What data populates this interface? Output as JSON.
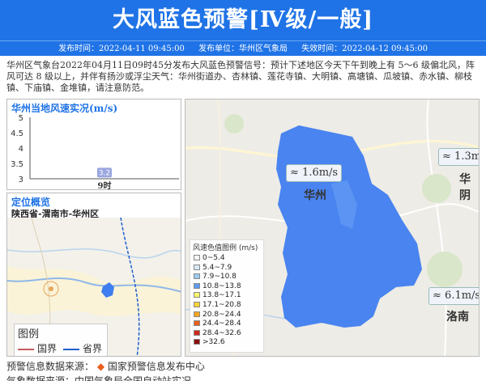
{
  "header": {
    "title": "大风蓝色预警[Ⅳ级/一般]",
    "publish_time": "发布时间：2022-04-11 09:45:00",
    "publisher": "发布单位：华州区气象局",
    "expire_time": "失效时间：2022-04-12 09:45:00"
  },
  "content": "华州区气象台2022年04月11日09时45分发布大风蓝色预警信号：预计下述地区今天下午到晚上有 5～6 级偏北风，阵风可达 8 级以上，并伴有扬沙或浮尘天气：华州街道办、杏林镇、莲花寺镇、大明镇、高塘镇、瓜坡镇、赤水镇、柳枝镇、下庙镇、金堆镇，请注意防范。",
  "wind_panel": {
    "title": "华州当地风速实况(m/s)",
    "chart_data": {
      "type": "bar",
      "categories": [
        "9时"
      ],
      "values": [
        3.2
      ],
      "value_labels": [
        "3.2"
      ],
      "ylim": [
        3,
        5
      ],
      "yticks": [
        "5",
        "4.5",
        "4",
        "3.5",
        "3"
      ],
      "colors": {
        "bar": "#9aa6e0"
      }
    }
  },
  "location_panel": {
    "title": "定位概览",
    "region": "陕西省-渭南市-华州区",
    "legend_title": "图例",
    "legend_items": [
      {
        "label": "国界",
        "color": "#c85a5a"
      },
      {
        "label": "省界",
        "color": "#1f5fcf"
      }
    ]
  },
  "map": {
    "scale_title": "风速色值图例 (m/s)",
    "scale": [
      {
        "label": "0~5.4",
        "color": "#f4f4f4"
      },
      {
        "label": "5.4~7.9",
        "color": "#d8e8f8"
      },
      {
        "label": "7.9~10.8",
        "color": "#9fcaf2"
      },
      {
        "label": "10.8~13.8",
        "color": "#5c9df0"
      },
      {
        "label": "13.8~17.1",
        "color": "#f9f76a"
      },
      {
        "label": "17.1~20.8",
        "color": "#f9d23a"
      },
      {
        "label": "20.8~24.4",
        "color": "#f5a623"
      },
      {
        "label": "24.4~28.4",
        "color": "#e8601c"
      },
      {
        "label": "28.4~32.6",
        "color": "#d0281c"
      },
      {
        "label": ">32.6",
        "color": "#8a0d0d"
      }
    ],
    "stations": [
      {
        "label": "1.6m/s",
        "place": "华州"
      },
      {
        "label": "1.3m",
        "place": "华阴"
      },
      {
        "label": "6.1m/s",
        "place": "洛南"
      }
    ],
    "region_color": "#3f7ef0"
  },
  "footer": {
    "source": "预警信息数据来源：",
    "source_name": "国家预警信息发布中心",
    "weather_source": "气象数据来源：中国气象局全国自动站实况"
  }
}
